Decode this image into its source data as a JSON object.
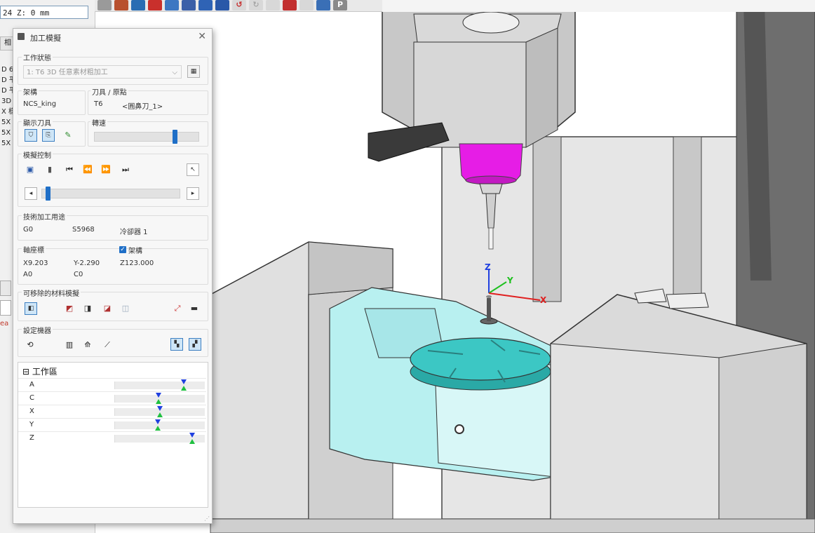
{
  "app": {
    "coord_readout": "24 Z:     0   mm",
    "side_list": [
      "D 6",
      "D 平",
      "D 平",
      "3D",
      "X 樣",
      "5X",
      "5X",
      "5X"
    ],
    "side_tab": "相",
    "side_red": "ea"
  },
  "viewport": {
    "axis_labels": {
      "x": "X",
      "y": "Y",
      "z": "Z"
    },
    "colors": {
      "spindle": "#e61de6",
      "table": "#3cc7c4",
      "fixture": "#b8f0f0",
      "machine": "#dcdcdc",
      "x_axis": "#e02020",
      "y_axis": "#20c020",
      "z_axis": "#2040e0"
    }
  },
  "dialog": {
    "title": "加工模擬",
    "job_status": {
      "label": "工作狀態",
      "selected": "1: T6 3D 任意素材粗加工"
    },
    "frame": {
      "label": "架構",
      "value": "NCS_king"
    },
    "tool_origin": {
      "label": "刀具 / 原點",
      "tool": "T6",
      "origin": "<圓鼻刀_1>"
    },
    "show_tool": {
      "label": "顯示刀具"
    },
    "speed": {
      "label": "轉速",
      "level": 0.78
    },
    "sim_control": {
      "label": "模擬控制",
      "progress": 0.03
    },
    "tech": {
      "label": "技術加工用途",
      "g": "G0",
      "s": "S5968",
      "coolant": "冷卻器  1"
    },
    "axis_coords": {
      "label": "軸座標",
      "frame_check_label": "架構",
      "frame_checked": true,
      "x": "X9.203",
      "y": "Y-2.290",
      "z": "Z123.000",
      "a": "A0",
      "c": "C0"
    },
    "removable_material": {
      "label": "可移除的材料模擬"
    },
    "setup_machine": {
      "label": "設定機器"
    },
    "workspace": {
      "header": "工作區",
      "collapse_glyph": "⊟",
      "axes": [
        {
          "name": "A",
          "level": 0.8
        },
        {
          "name": "C",
          "level": 0.49
        },
        {
          "name": "X",
          "level": 0.51
        },
        {
          "name": "Y",
          "level": 0.48
        },
        {
          "name": "Z",
          "level": 0.9
        }
      ]
    }
  }
}
